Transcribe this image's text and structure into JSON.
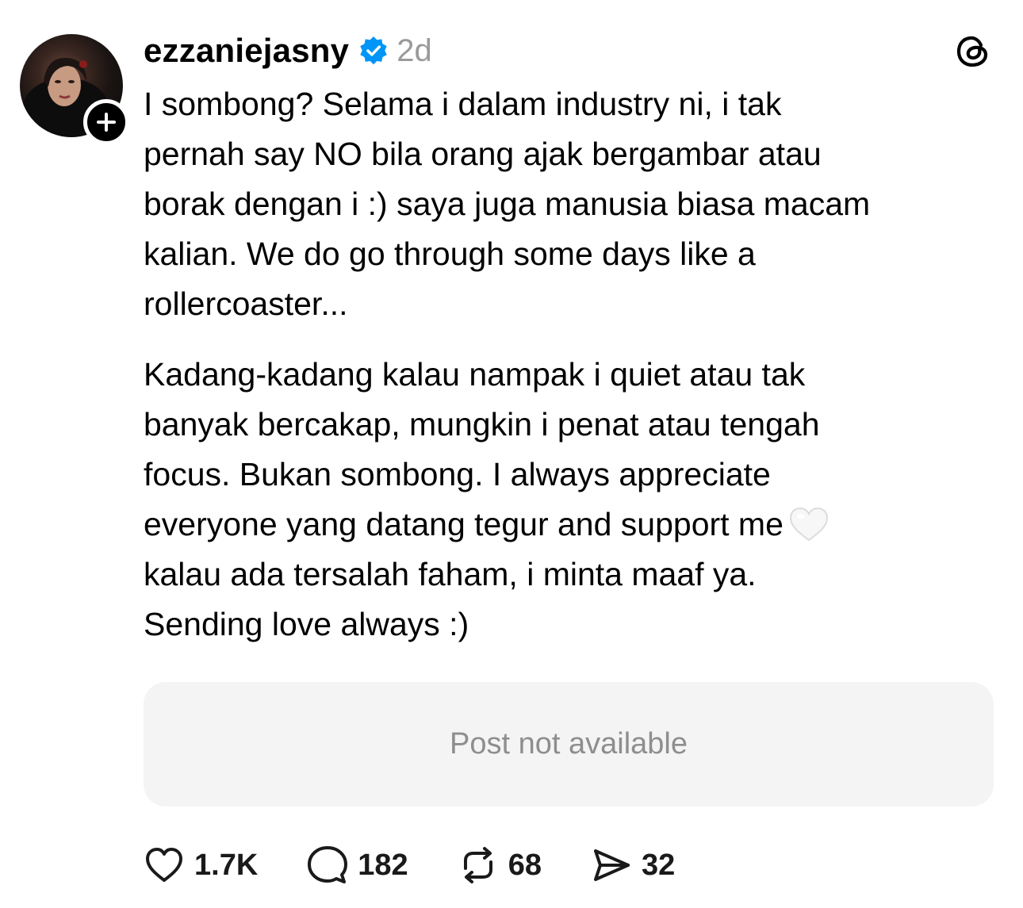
{
  "post": {
    "username": "ezzaniejasny",
    "verified": true,
    "timestamp": "2d",
    "paragraphs": [
      [
        "I sombong? Selama i dalam industry ni, i tak",
        "pernah say NO bila orang ajak bergambar atau",
        "borak dengan i :) saya juga manusia biasa macam",
        "kalian. We do go through some days like a",
        "rollercoaster..."
      ],
      [
        "Kadang-kadang kalau nampak i quiet atau tak",
        "banyak bercakap, mungkin i penat atau tengah",
        "focus. Bukan sombong. I always appreciate",
        "everyone yang datang tegur and support me",
        "kalau ada tersalah faham, i minta maaf ya.",
        "Sending love always :)"
      ]
    ],
    "emoji": "white-heart",
    "embed_status": "Post not available"
  },
  "actions": {
    "likes": "1.7K",
    "replies": "182",
    "reposts": "68",
    "shares": "32"
  },
  "icons": {
    "follow": "plus-icon",
    "verified": "verified-badge-icon",
    "app_logo": "threads-logo-icon",
    "like": "heart-icon",
    "reply": "comment-icon",
    "repost": "repost-icon",
    "share": "send-icon"
  },
  "colors": {
    "verified_blue": "#0095f6",
    "muted_text": "#9a9a9a",
    "card_bg": "#f4f4f4"
  }
}
